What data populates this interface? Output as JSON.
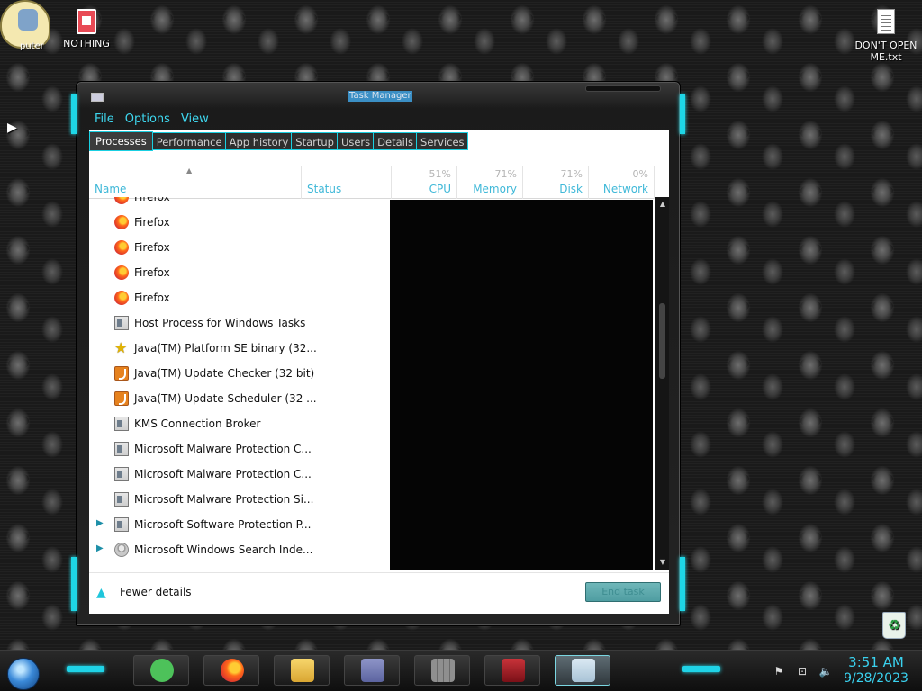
{
  "desktop": {
    "computer_label": "puter",
    "nothing_label": "NOTHING",
    "dontopen_label": "DON'T OPEN\nME.txt",
    "recycle_label": "Recycle Bin"
  },
  "window": {
    "title": "Task Manager",
    "menu": [
      "File",
      "Options",
      "View"
    ],
    "tabs": [
      "Processes",
      "Performance",
      "App history",
      "Startup",
      "Users",
      "Details",
      "Services"
    ],
    "columns": {
      "name": "Name",
      "status": "Status",
      "cpu_pct": "51%",
      "cpu": "CPU",
      "memory_pct": "71%",
      "memory": "Memory",
      "disk_pct": "71%",
      "disk": "Disk",
      "network_pct": "0%",
      "network": "Network"
    },
    "rows": [
      {
        "name": "Firefox",
        "icon": "firefox-icon",
        "expand": false
      },
      {
        "name": "Firefox",
        "icon": "firefox-icon",
        "expand": false
      },
      {
        "name": "Firefox",
        "icon": "firefox-icon",
        "expand": false
      },
      {
        "name": "Firefox",
        "icon": "firefox-icon",
        "expand": false
      },
      {
        "name": "Firefox",
        "icon": "firefox-icon",
        "expand": false
      },
      {
        "name": "Host Process for Windows Tasks",
        "icon": "window-icon",
        "expand": false
      },
      {
        "name": "Java(TM) Platform SE binary (32...",
        "icon": "java-star-icon",
        "expand": false
      },
      {
        "name": "Java(TM) Update Checker (32 bit)",
        "icon": "java-icon",
        "expand": false
      },
      {
        "name": "Java(TM) Update Scheduler (32 ...",
        "icon": "java-icon",
        "expand": false
      },
      {
        "name": "KMS Connection Broker",
        "icon": "window-icon",
        "expand": false
      },
      {
        "name": "Microsoft Malware Protection C...",
        "icon": "window-icon",
        "expand": false
      },
      {
        "name": "Microsoft Malware Protection C...",
        "icon": "window-icon",
        "expand": false
      },
      {
        "name": "Microsoft Malware Protection Si...",
        "icon": "window-icon",
        "expand": false
      },
      {
        "name": "Microsoft Software Protection P...",
        "icon": "window-icon",
        "expand": true
      },
      {
        "name": "Microsoft Windows Search Inde...",
        "icon": "search-person-icon",
        "expand": true
      }
    ],
    "footer": {
      "fewer_details": "Fewer details",
      "end_task": "End task"
    }
  },
  "taskbar": {
    "time": "3:51 AM",
    "date": "9/28/2023"
  },
  "colors": {
    "accent": "#1ed6e6",
    "menu_text": "#3ed8f0",
    "column_label": "#3fb8d8"
  }
}
